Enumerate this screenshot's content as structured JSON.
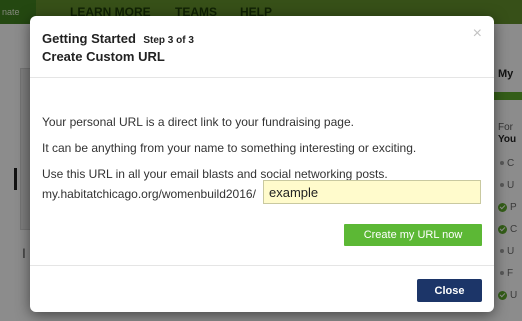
{
  "background": {
    "nav_badge": "nate",
    "nav_items": [
      "LEARN MORE",
      "TEAMS",
      "HELP"
    ],
    "left_char": "I",
    "right_title": "My",
    "right_line1": "For",
    "right_line2": "You",
    "right_list": [
      {
        "marker": "bullet",
        "label": "C"
      },
      {
        "marker": "bullet",
        "label": "U"
      },
      {
        "marker": "check",
        "label": "P"
      },
      {
        "marker": "check",
        "label": "C"
      },
      {
        "marker": "bullet",
        "label": "U"
      },
      {
        "marker": "bullet",
        "label": "F"
      },
      {
        "marker": "check",
        "label": "U"
      }
    ]
  },
  "modal": {
    "title": "Getting Started",
    "step": "Step 3 of 3",
    "subtitle": "Create Custom URL",
    "close_icon": "×",
    "body": {
      "line1": "Your personal URL is a direct link to your fundraising page.",
      "line2": "It can be anything from your name to something interesting or exciting.",
      "line3": "Use this URL in all your email blasts and social networking posts.",
      "url_prefix": "my.habitatchicago.org/womenbuild2016/",
      "url_value": "example",
      "create_button": "Create my URL now"
    },
    "footer": {
      "close_button": "Close"
    }
  },
  "colors": {
    "nav_green": "#5f8a2a",
    "create_button_green": "#5cb835",
    "close_button_navy": "#1c3568",
    "input_background": "#fffbcc"
  }
}
